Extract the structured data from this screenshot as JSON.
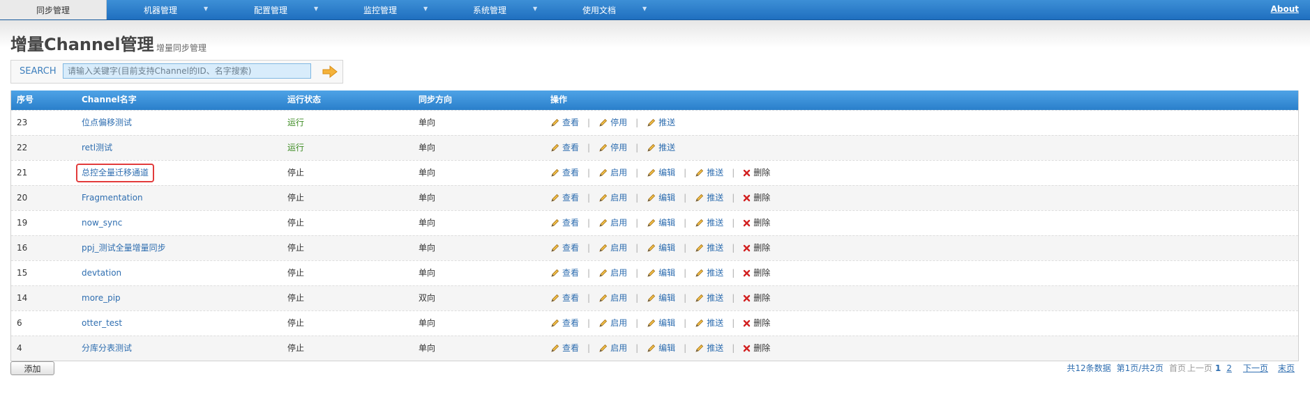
{
  "nav": {
    "items": [
      {
        "label": "同步管理",
        "active": true
      },
      {
        "label": "机器管理",
        "active": false
      },
      {
        "label": "配置管理",
        "active": false
      },
      {
        "label": "监控管理",
        "active": false
      },
      {
        "label": "系统管理",
        "active": false
      },
      {
        "label": "使用文档",
        "active": false
      }
    ],
    "dropdown_glyph": "▼",
    "about": "About"
  },
  "header": {
    "title": "增量Channel管理",
    "subtitle": "增量同步管理"
  },
  "search": {
    "label": "SEARCH",
    "placeholder": "请输入关键字(目前支持Channel的ID、名字搜索)",
    "go_icon": "arrow-right-icon"
  },
  "table": {
    "columns": [
      "序号",
      "Channel名字",
      "运行状态",
      "同步方向",
      "操作"
    ],
    "rows": [
      {
        "id": "23",
        "name": "位点偏移测试",
        "status": "运行",
        "direction": "单向",
        "ops": [
          "查看",
          "停用",
          "推送"
        ]
      },
      {
        "id": "22",
        "name": "retl测试",
        "status": "运行",
        "direction": "单向",
        "ops": [
          "查看",
          "停用",
          "推送"
        ]
      },
      {
        "id": "21",
        "name": "总控全量迁移通道",
        "status": "停止",
        "direction": "单向",
        "ops": [
          "查看",
          "启用",
          "编辑",
          "推送",
          "删除"
        ],
        "highlighted": true
      },
      {
        "id": "20",
        "name": "Fragmentation",
        "status": "停止",
        "direction": "单向",
        "ops": [
          "查看",
          "启用",
          "编辑",
          "推送",
          "删除"
        ]
      },
      {
        "id": "19",
        "name": "now_sync",
        "status": "停止",
        "direction": "单向",
        "ops": [
          "查看",
          "启用",
          "编辑",
          "推送",
          "删除"
        ]
      },
      {
        "id": "16",
        "name": "ppj_测试全量增量同步",
        "status": "停止",
        "direction": "单向",
        "ops": [
          "查看",
          "启用",
          "编辑",
          "推送",
          "删除"
        ]
      },
      {
        "id": "15",
        "name": "devtation",
        "status": "停止",
        "direction": "单向",
        "ops": [
          "查看",
          "启用",
          "编辑",
          "推送",
          "删除"
        ]
      },
      {
        "id": "14",
        "name": "more_pip",
        "status": "停止",
        "direction": "双向",
        "ops": [
          "查看",
          "启用",
          "编辑",
          "推送",
          "删除"
        ]
      },
      {
        "id": "6",
        "name": "otter_test",
        "status": "停止",
        "direction": "单向",
        "ops": [
          "查看",
          "启用",
          "编辑",
          "推送",
          "删除"
        ]
      },
      {
        "id": "4",
        "name": "分库分表测试",
        "status": "停止",
        "direction": "单向",
        "ops": [
          "查看",
          "启用",
          "编辑",
          "推送",
          "删除"
        ]
      }
    ],
    "separator": "|"
  },
  "footer": {
    "add_label": "添加",
    "pager": {
      "total": "共12条数据",
      "page_info": "第1页/共2页",
      "first": "首页",
      "prev": "上一页",
      "page1": "1",
      "page2": "2",
      "next": "下一页",
      "last": "末页"
    }
  },
  "colors": {
    "nav_blue": "#2a7fcb",
    "link_blue": "#2f6eb0",
    "running_green": "#3a8a20",
    "highlight_red": "#e23b3b",
    "delete_red": "#d22020"
  }
}
